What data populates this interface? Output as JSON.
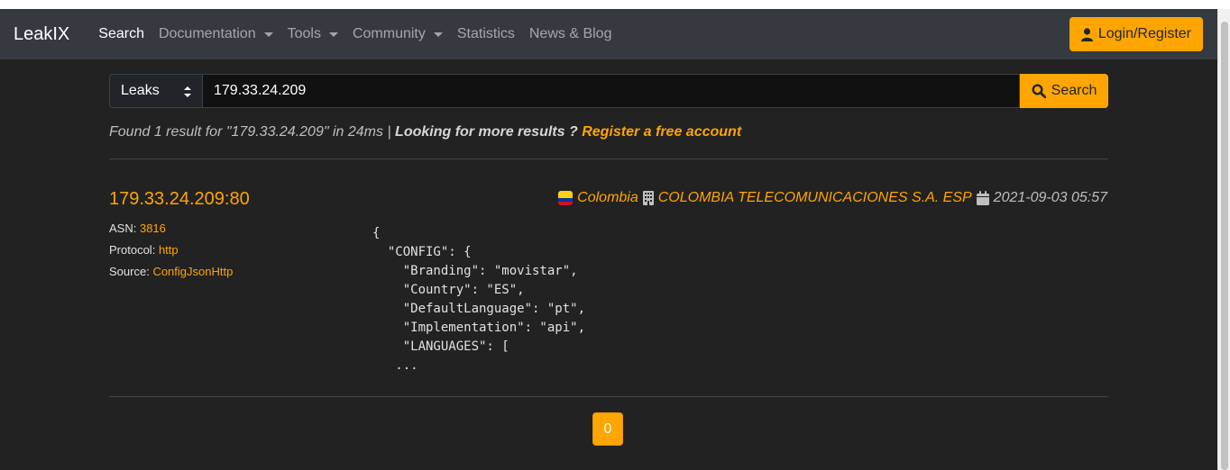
{
  "navbar": {
    "brand": "LeakIX",
    "items": [
      {
        "label": "Search",
        "active": true,
        "dropdown": false
      },
      {
        "label": "Documentation",
        "active": false,
        "dropdown": true
      },
      {
        "label": "Tools",
        "active": false,
        "dropdown": true
      },
      {
        "label": "Community",
        "active": false,
        "dropdown": true
      },
      {
        "label": "Statistics",
        "active": false,
        "dropdown": false
      },
      {
        "label": "News & Blog",
        "active": false,
        "dropdown": false
      }
    ],
    "login_label": "Login/Register"
  },
  "search": {
    "scope_value": "Leaks",
    "query_value": "179.33.24.209",
    "button_label": "Search"
  },
  "summary": {
    "prefix": "Found 1 result for \"179.33.24.209\" in 24ms | ",
    "more": "Looking for more results ? ",
    "register_link": "Register a free account"
  },
  "result": {
    "title": "179.33.24.209:80",
    "asn_label": "ASN:",
    "asn_value": "3816",
    "protocol_label": "Protocol:",
    "protocol_value": "http",
    "source_label": "Source:",
    "source_value": "ConfigJsonHttp",
    "country": "Colombia",
    "organization": "COLOMBIA TELECOMUNICACIONES S.A. ESP",
    "date": "2021-09-03 05:57",
    "snippet": "{\n  \"CONFIG\": {\n    \"Branding\": \"movistar\",\n    \"Country\": \"ES\",\n    \"DefaultLanguage\": \"pt\",\n    \"Implementation\": \"api\",\n    \"LANGUAGES\": [\n   ..."
  },
  "pagination": {
    "current_page": "0"
  },
  "colors": {
    "accent": "#ffa500",
    "navbar": "#343a40",
    "background": "#222222"
  }
}
